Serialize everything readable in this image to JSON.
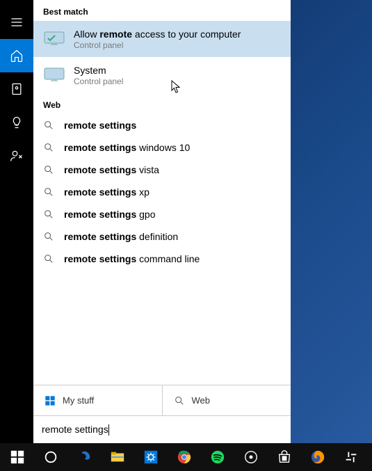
{
  "sidebar": {
    "items": [
      "menu",
      "home",
      "app-square",
      "lightbulb",
      "person-share"
    ]
  },
  "sections": {
    "best_match_label": "Best match",
    "web_label": "Web"
  },
  "results": [
    {
      "title_pre": "Allow ",
      "title_bold": "remote",
      "title_post": " access to your computer",
      "sub": "Control panel",
      "selected": true
    },
    {
      "title_pre": "",
      "title_bold": "",
      "title_post": "System",
      "sub": "Control panel",
      "selected": false
    }
  ],
  "web_suggestions": [
    {
      "bold": "remote settings",
      "rest": ""
    },
    {
      "bold": "remote settings",
      "rest": " windows 10"
    },
    {
      "bold": "remote settings",
      "rest": " vista"
    },
    {
      "bold": "remote settings",
      "rest": " xp"
    },
    {
      "bold": "remote settings",
      "rest": " gpo"
    },
    {
      "bold": "remote settings",
      "rest": " definition"
    },
    {
      "bold": "remote settings",
      "rest": " command line"
    }
  ],
  "scope": {
    "mystuff": "My stuff",
    "web": "Web"
  },
  "search": {
    "value": "remote settings"
  },
  "taskbar": {
    "items": [
      "start",
      "cortana",
      "edge",
      "file-explorer",
      "settings",
      "chrome",
      "spotify",
      "media",
      "store",
      "firefox",
      "slack"
    ]
  }
}
